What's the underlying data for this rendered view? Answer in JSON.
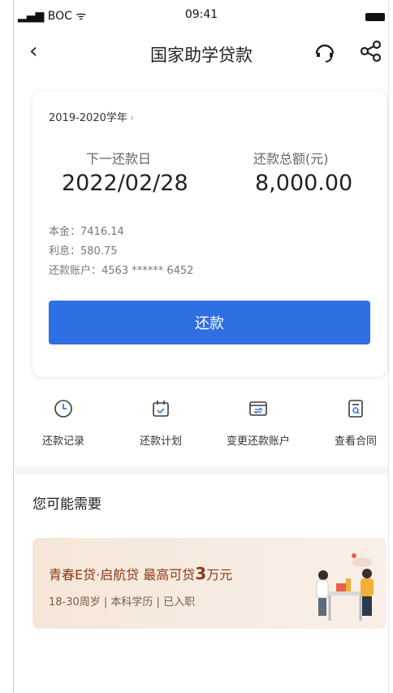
{
  "status": {
    "carrier": "BOC",
    "time": "09:41"
  },
  "nav": {
    "title": "国家助学贷款"
  },
  "card": {
    "year": "2019-2020学年",
    "next_date_label": "下一还款日",
    "next_date_value": "2022/02/28",
    "total_label": "还款总额(元)",
    "total_value": "8,000.00",
    "principal": "本金：7416.14",
    "interest": "利息：580.75",
    "account": "还款账户：4563 ****** 6452",
    "pay_button": "还款"
  },
  "shortcuts": [
    {
      "label": "还款记录",
      "icon": "clock-icon"
    },
    {
      "label": "还款计划",
      "icon": "calendar-icon"
    },
    {
      "label": "变更还款账户",
      "icon": "card-swap-icon"
    },
    {
      "label": "查看合同",
      "icon": "document-search-icon"
    }
  ],
  "section": {
    "title": "您可能需要"
  },
  "banner": {
    "title_prefix": "青春E贷·启航贷  最高可贷",
    "title_amount": "3",
    "title_suffix": "万元",
    "subtitle": "18-30周岁 | 本科学历 | 已入职"
  },
  "colors": {
    "primary": "#2e6fe3",
    "banner_text": "#8b3b17",
    "icon_blue": "#3b7be8"
  }
}
